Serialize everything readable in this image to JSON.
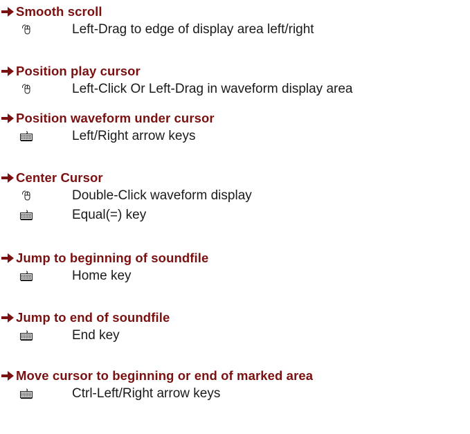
{
  "sections": [
    {
      "title": "Smooth scroll",
      "items": [
        {
          "icon": "mouse-icon",
          "text": "Left-Drag to edge of display area left/right"
        }
      ]
    },
    {
      "title": "Position play cursor",
      "items": [
        {
          "icon": "mouse-icon",
          "text": "Left-Click Or Left-Drag in waveform display area"
        }
      ]
    },
    {
      "title": "Position waveform under cursor",
      "items": [
        {
          "icon": "keyboard-icon",
          "text": "Left/Right arrow keys"
        }
      ]
    },
    {
      "title": "Center Cursor",
      "items": [
        {
          "icon": "mouse-icon",
          "text": "Double-Click waveform display"
        },
        {
          "icon": "keyboard-icon",
          "text": "Equal(=) key"
        }
      ]
    },
    {
      "title": "Jump to beginning of soundfile",
      "items": [
        {
          "icon": "keyboard-icon",
          "text": "Home key"
        }
      ]
    },
    {
      "title": "Jump to end of soundfile",
      "items": [
        {
          "icon": "keyboard-icon",
          "text": "End key"
        }
      ]
    },
    {
      "title": "Move cursor to beginning or end of marked area",
      "items": [
        {
          "icon": "keyboard-icon",
          "text": "Ctrl-Left/Right arrow keys"
        }
      ]
    }
  ],
  "colors": {
    "heading": "#7b1010",
    "text": "#1a1a1a"
  }
}
